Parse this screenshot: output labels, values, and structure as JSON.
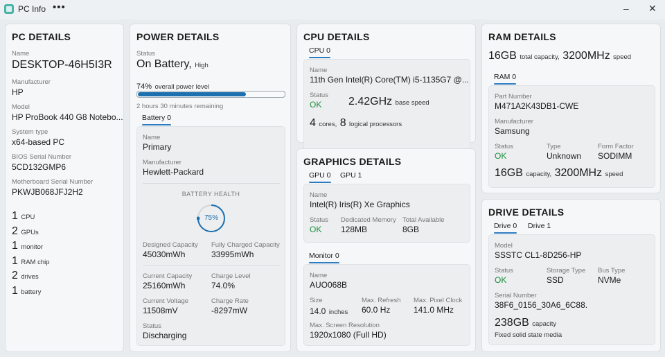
{
  "window": {
    "title": "PC Info",
    "more": "•••",
    "minimize": "–",
    "close": "✕"
  },
  "pc": {
    "title": "PC DETAILS",
    "name_label": "Name",
    "name": "DESKTOP-46H5I3R",
    "manufacturer_label": "Manufacturer",
    "manufacturer": "HP",
    "model_label": "Model",
    "model": "HP ProBook 440 G8 Notebo...",
    "system_type_label": "System type",
    "system_type": "x64-based PC",
    "bios_label": "BIOS Serial Number",
    "bios": "5CD132GMP6",
    "mobo_label": "Motherboard Serial Number",
    "mobo": "PKWJB068JFJ2H2",
    "counts": [
      {
        "num": "1",
        "label": "CPU"
      },
      {
        "num": "2",
        "label": "GPUs"
      },
      {
        "num": "1",
        "label": "monitor"
      },
      {
        "num": "1",
        "label": "RAM chip"
      },
      {
        "num": "2",
        "label": "drives"
      },
      {
        "num": "1",
        "label": "battery"
      }
    ]
  },
  "power": {
    "title": "POWER DETAILS",
    "status_label": "Status",
    "status": "On Battery,",
    "status_level": "High",
    "level_percent": "74%",
    "level_text": "overall power level",
    "level_value": 0.74,
    "remaining": "2 hours 30 minutes remaining",
    "tab": "Battery 0",
    "name_label": "Name",
    "name": "Primary",
    "manufacturer_label": "Manufacturer",
    "manufacturer": "Hewlett-Packard",
    "health_label": "BATTERY HEALTH",
    "health": "75%",
    "health_value": 0.75,
    "designed_label": "Designed Capacity",
    "designed": "45030mWh",
    "full_label": "Fully Charged Capacity",
    "full": "33995mWh",
    "current_label": "Current Capacity",
    "current": "25160mWh",
    "charge_level_label": "Charge Level",
    "charge_level": "74.0%",
    "voltage_label": "Current Voltage",
    "voltage": "11508mV",
    "rate_label": "Charge Rate",
    "rate": "-8297mW",
    "bstatus_label": "Status",
    "bstatus": "Discharging"
  },
  "cpu": {
    "title": "CPU DETAILS",
    "tab": "CPU 0",
    "name_label": "Name",
    "name": "11th Gen Intel(R) Core(TM) i5-1135G7 @...",
    "status_label": "Status",
    "status": "OK",
    "speed": "2.42GHz",
    "speed_text": "base speed",
    "cores": "4",
    "cores_text": "cores,",
    "logical": "8",
    "logical_text": "logical processors"
  },
  "gpu": {
    "title": "GRAPHICS DETAILS",
    "tabs": [
      "GPU 0",
      "GPU 1"
    ],
    "name_label": "Name",
    "name": "Intel(R) Iris(R) Xe Graphics",
    "status_label": "Status",
    "status": "OK",
    "dedicated_label": "Dedicated Memory",
    "dedicated": "128MB",
    "available_label": "Total Available",
    "available": "8GB",
    "monitor_tab": "Monitor 0",
    "mname_label": "Name",
    "mname": "AUO068B",
    "size_label": "Size",
    "size": "14.0",
    "size_unit": "inches",
    "refresh_label": "Max. Refresh",
    "refresh": "60.0 Hz",
    "clock_label": "Max. Pixel Clock",
    "clock": "141.0 MHz",
    "res_label": "Max. Screen Resolution",
    "res": "1920x1080 (Full HD)"
  },
  "ram": {
    "title": "RAM DETAILS",
    "total": "16GB",
    "total_text": "total capacity,",
    "speed": "3200MHz",
    "speed_text": "speed",
    "tab": "RAM 0",
    "part_label": "Part Number",
    "part": "M471A2K43DB1-CWE",
    "manufacturer_label": "Manufacturer",
    "manufacturer": "Samsung",
    "status_label": "Status",
    "status": "OK",
    "type_label": "Type",
    "type": "Unknown",
    "form_label": "Form Factor",
    "form": "SODIMM",
    "cap": "16GB",
    "cap_text": "capacity,",
    "cspeed": "3200MHz",
    "cspeed_text": "speed"
  },
  "drive": {
    "title": "DRIVE DETAILS",
    "tabs": [
      "Drive 0",
      "Drive 1"
    ],
    "model_label": "Model",
    "model": "SSSTC CL1-8D256-HP",
    "status_label": "Status",
    "status": "OK",
    "stype_label": "Storage Type",
    "stype": "SSD",
    "bus_label": "Bus Type",
    "bus": "NVMe",
    "serial_label": "Serial Number",
    "serial": "38F6_0156_30A6_6C88.",
    "cap": "238GB",
    "cap_text": "capacity",
    "media": "Fixed solid state media"
  },
  "colors": {
    "accent": "#1d70b0",
    "ok": "#1a8f3c",
    "background": "#e9ecef",
    "panel": "#f6f7f8"
  }
}
